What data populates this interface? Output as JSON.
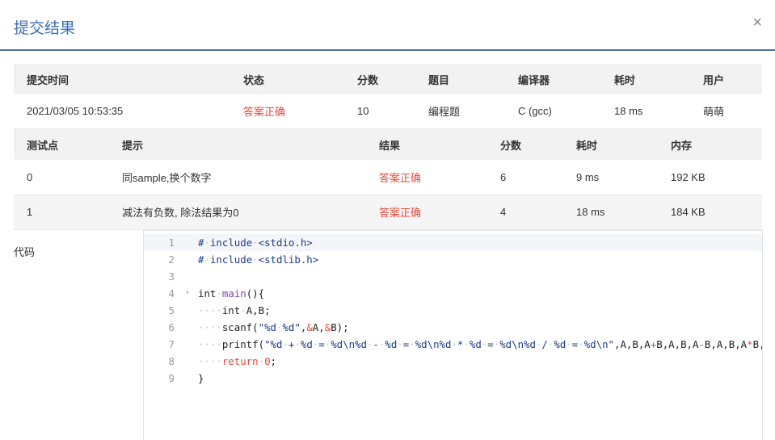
{
  "modal": {
    "title": "提交结果",
    "close_label": "×"
  },
  "summary": {
    "headers": [
      "提交时间",
      "状态",
      "分数",
      "题目",
      "编译器",
      "耗时",
      "用户"
    ],
    "row": [
      "2021/03/05 10:53:35",
      "答案正确",
      "10",
      "编程题",
      "C (gcc)",
      "18 ms",
      "萌萌"
    ]
  },
  "tests": {
    "headers": [
      "测试点",
      "提示",
      "结果",
      "分数",
      "耗时",
      "内存"
    ],
    "rows": [
      [
        "0",
        "同sample,换个数字",
        "答案正确",
        "6",
        "9 ms",
        "192 KB"
      ],
      [
        "1",
        "减法有负数, 除法结果为0",
        "答案正确",
        "4",
        "18 ms",
        "184 KB"
      ]
    ]
  },
  "code_label": "代码",
  "code_lines": [
    "# include <stdio.h>",
    "# include <stdlib.h>",
    "",
    "int main(){",
    "    int A,B;",
    "    scanf(\"%d %d\",&A,&B);",
    "    printf(\"%d + %d = %d\\n%d - %d = %d\\n%d * %d = %d\\n%d / %d = %d\\n\",A,B,A+B,A,B,A-B,A,B,A*B,A,B,A/B);",
    "    return 0;",
    "}"
  ],
  "line_numbers": [
    "1",
    "2",
    "3",
    "4",
    "5",
    "6",
    "7",
    "8",
    "9"
  ]
}
